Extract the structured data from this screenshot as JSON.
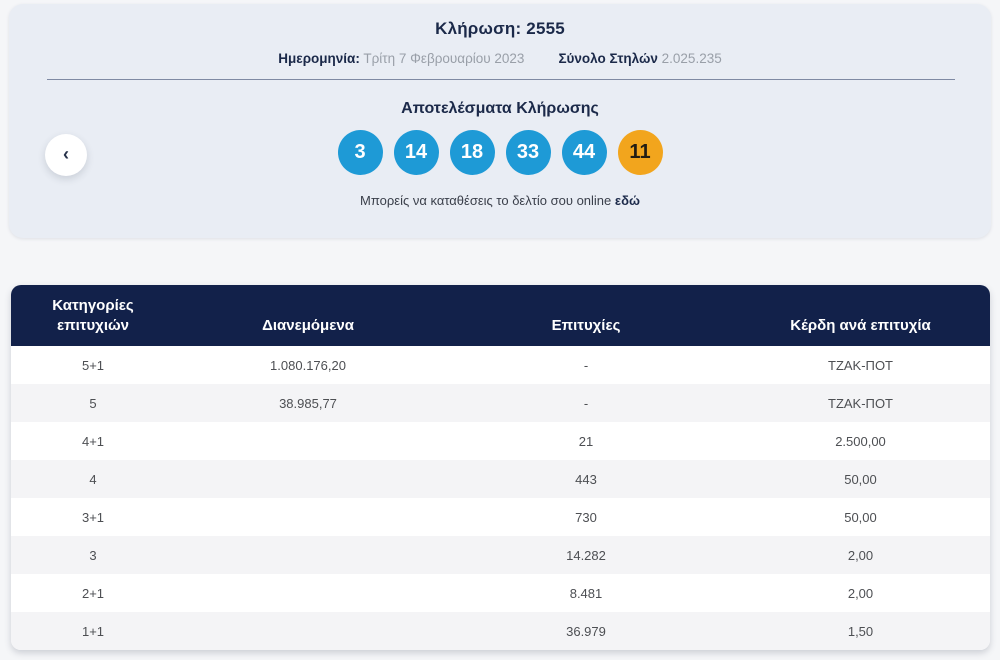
{
  "draw": {
    "title": "Κλήρωση: 2555",
    "date_label": "Ημερομηνία:",
    "date_value": "Τρίτη 7 Φεβρουαρίου 2023",
    "columns_label": "Σύνολο Στηλών",
    "columns_value": "2.025.235",
    "results_title": "Αποτελέσματα Κλήρωσης",
    "winning_numbers": {
      "main": [
        "3",
        "14",
        "18",
        "33",
        "44"
      ],
      "bonus": [
        "11"
      ]
    },
    "cta_text": "Μπορείς να καταθέσεις το δελτίο σου online",
    "cta_link": "εδώ",
    "back_chevron": "‹"
  },
  "table": {
    "headers": [
      "Κατηγορίες επιτυχιών",
      "Διανεμόμενα",
      "Επιτυχίες",
      "Κέρδη ανά επιτυχία"
    ],
    "rows": [
      {
        "category": "5+1",
        "distributed": "1.080.176,20",
        "winners": "-",
        "prize": "ΤΖΑΚ-ΠΟΤ"
      },
      {
        "category": "5",
        "distributed": "38.985,77",
        "winners": "-",
        "prize": "ΤΖΑΚ-ΠΟΤ"
      },
      {
        "category": "4+1",
        "distributed": "",
        "winners": "21",
        "prize": "2.500,00"
      },
      {
        "category": "4",
        "distributed": "",
        "winners": "443",
        "prize": "50,00"
      },
      {
        "category": "3+1",
        "distributed": "",
        "winners": "730",
        "prize": "50,00"
      },
      {
        "category": "3",
        "distributed": "",
        "winners": "14.282",
        "prize": "2,00"
      },
      {
        "category": "2+1",
        "distributed": "",
        "winners": "8.481",
        "prize": "2,00"
      },
      {
        "category": "1+1",
        "distributed": "",
        "winners": "36.979",
        "prize": "1,50"
      }
    ]
  },
  "colors": {
    "header_navy": "#12214a",
    "ball_blue": "#1e9ad6",
    "ball_bonus_orange": "#f2a51d",
    "card_background": "#e9edf4",
    "page_background": "#f5f6f8"
  }
}
